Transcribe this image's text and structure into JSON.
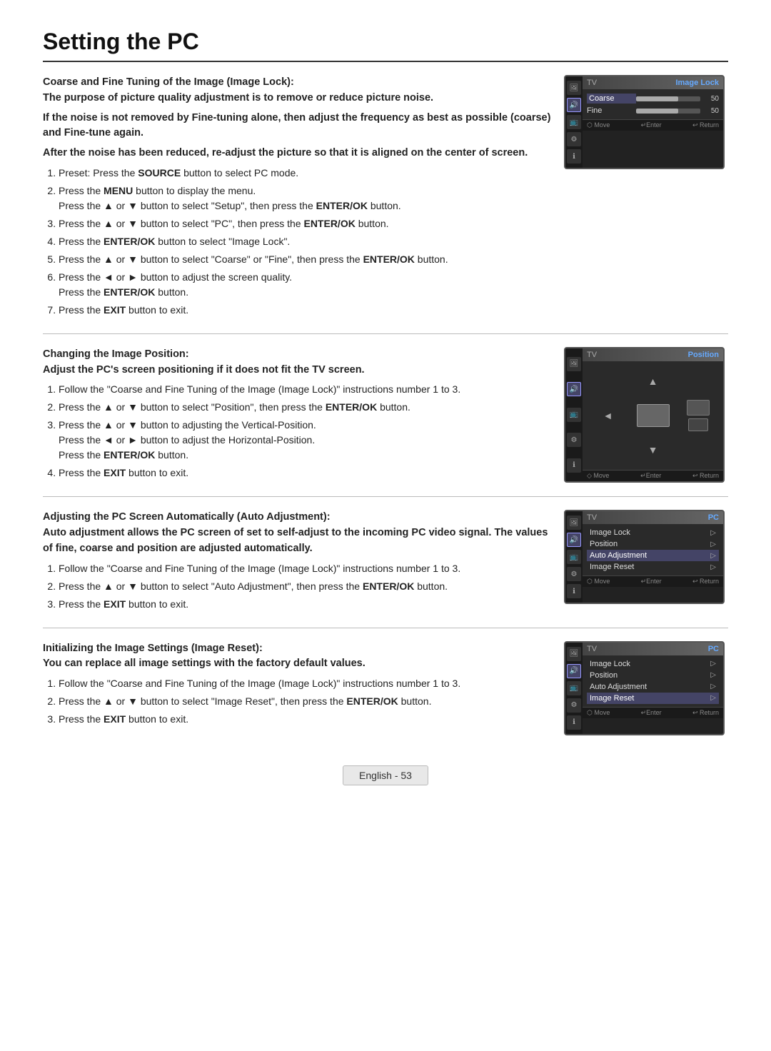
{
  "page": {
    "title": "Setting the PC",
    "footer": "English - 53"
  },
  "sections": [
    {
      "id": "image-lock",
      "heading_line1": "Coarse and Fine Tuning of the Image (Image Lock):",
      "heading_line2": "The purpose of picture quality adjustment is to remove or reduce picture noise.",
      "heading_line3": "If the noise is not removed by Fine-tuning alone, then adjust the frequency as best as possible (coarse) and Fine-tune again.",
      "heading_line4": "After the noise has been reduced, re-adjust the picture so that it is aligned on the center of screen.",
      "steps": [
        "Preset: Press the SOURCE button to select PC mode.",
        "Press the MENU button to display the menu.\nPress the ▲ or ▼ button to select \"Setup\", then press the ENTER/OK button.",
        "Press the ▲ or ▼ button to select \"PC\", then press the ENTER/OK button.",
        "Press the ENTER/OK button to select \"Image Lock\".",
        "Press the ▲ or ▼ button to select \"Coarse\" or \"Fine\", then press the ENTER/OK button.",
        "Press the ◄ or ► button to adjust the screen quality.\nPress the ENTER/OK button.",
        "Press the EXIT button to exit."
      ],
      "tv": {
        "label": "TV",
        "title": "Image Lock",
        "type": "sliders",
        "rows": [
          {
            "label": "Coarse",
            "value": 50,
            "percent": 65,
            "selected": true
          },
          {
            "label": "Fine",
            "value": 50,
            "percent": 65,
            "selected": false
          }
        ],
        "footer": [
          "⬡ Move",
          "↵Enter",
          "↩ Return"
        ]
      }
    },
    {
      "id": "position",
      "heading_line1": "Changing the Image Position:",
      "heading_line2": "Adjust the PC's screen positioning if it does not fit the TV screen.",
      "steps": [
        "Follow the \"Coarse and Fine Tuning of the Image (Image Lock)\" instructions number 1 to 3.",
        "Press the ▲ or ▼ button to select \"Position\", then press the ENTER/OK button.",
        "Press the ▲ or ▼ button to adjusting the Vertical-Position.\nPress the ◄ or ► button to adjust the Horizontal-Position.\nPress the ENTER/OK button.",
        "Press the EXIT button to exit."
      ],
      "tv": {
        "label": "TV",
        "title": "Position",
        "type": "position",
        "footer": [
          "◇ Move",
          "↵Enter",
          "↩ Return"
        ]
      }
    },
    {
      "id": "auto-adjustment",
      "heading_line1": "Adjusting the PC Screen Automatically (Auto Adjustment):",
      "heading_line2": "Auto adjustment allows the PC screen of set to self-adjust to the incoming PC video signal. The values of fine, coarse and position are adjusted automatically.",
      "steps": [
        "Follow the \"Coarse and Fine Tuning of the Image (Image Lock)\" instructions number 1 to 3.",
        "Press the ▲ or ▼ button to select \"Auto Adjustment\", then press the ENTER/OK button.",
        "Press the EXIT button to exit."
      ],
      "tv": {
        "label": "TV",
        "title": "PC",
        "type": "menu",
        "rows": [
          {
            "label": "Image Lock",
            "selected": false
          },
          {
            "label": "Position",
            "selected": false
          },
          {
            "label": "Auto Adjustment",
            "selected": true
          },
          {
            "label": "Image Reset",
            "selected": false
          }
        ],
        "footer": [
          "⬡ Move",
          "↵Enter",
          "↩ Return"
        ]
      }
    },
    {
      "id": "image-reset",
      "heading_line1": "Initializing the Image Settings (Image Reset):",
      "heading_line2": "You can replace all image settings with the factory default values.",
      "steps": [
        "Follow the \"Coarse and Fine Tuning of the Image (Image Lock)\" instructions number 1 to 3.",
        "Press the ▲ or ▼ button to select \"Image Reset\", then press the ENTER/OK button.",
        "Press the EXIT button to exit."
      ],
      "tv": {
        "label": "TV",
        "title": "PC",
        "type": "menu",
        "rows": [
          {
            "label": "Image Lock",
            "selected": false
          },
          {
            "label": "Position",
            "selected": false
          },
          {
            "label": "Auto Adjustment",
            "selected": false
          },
          {
            "label": "Image Reset",
            "selected": true
          }
        ],
        "footer": [
          "⬡ Move",
          "↵Enter",
          "↩ Return"
        ]
      }
    }
  ],
  "icons": [
    "picture-icon",
    "audio-icon",
    "channel-icon",
    "setup-icon",
    "info-icon"
  ]
}
